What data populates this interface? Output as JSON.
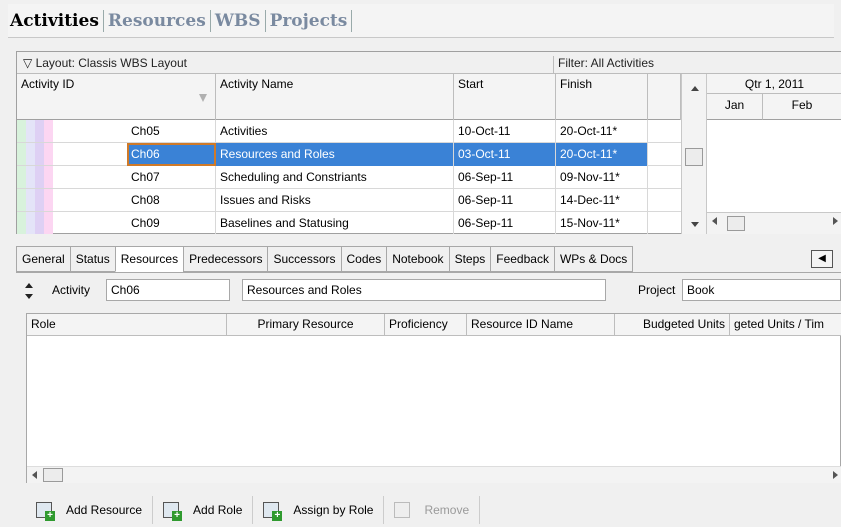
{
  "nav": {
    "tabs": [
      "Activities",
      "Resources",
      "WBS",
      "Projects"
    ]
  },
  "table": {
    "layout": "Layout: Classis WBS Layout",
    "filter": "Filter: All Activities",
    "columns": [
      "Activity ID",
      "Activity Name",
      "Start",
      "Finish"
    ],
    "rows": [
      {
        "id": "Ch05",
        "name": "Activities",
        "start": "10-Oct-11",
        "finish": "20-Oct-11*"
      },
      {
        "id": "Ch06",
        "name": "Resources and Roles",
        "start": "03-Oct-11",
        "finish": "20-Oct-11*"
      },
      {
        "id": "Ch07",
        "name": "Scheduling and Constriants",
        "start": "06-Sep-11",
        "finish": "09-Nov-11*"
      },
      {
        "id": "Ch08",
        "name": "Issues and Risks",
        "start": "06-Sep-11",
        "finish": "14-Dec-11*"
      },
      {
        "id": "Ch09",
        "name": "Baselines and Statusing",
        "start": "06-Sep-11",
        "finish": "15-Nov-11*"
      }
    ],
    "stripe_colors": [
      "#d8f2dc",
      "#e4e4f8",
      "#ded0f4",
      "#fcd6f2"
    ]
  },
  "gantt": {
    "quarter": "Qtr 1, 2011",
    "months": [
      "Jan",
      "Feb"
    ]
  },
  "detail": {
    "tabs": [
      "General",
      "Status",
      "Resources",
      "Predecessors",
      "Successors",
      "Codes",
      "Notebook",
      "Steps",
      "Feedback",
      "WPs & Docs"
    ],
    "activity_label": "Activity",
    "activity_id": "Ch06",
    "activity_name": "Resources and Roles",
    "project_label": "Project",
    "project": "Book",
    "grid_columns": [
      "Role",
      "Primary Resource",
      "Proficiency",
      "Resource ID Name",
      "Budgeted Units",
      "geted Units / Tim"
    ],
    "buttons": [
      "Add Resource",
      "Add Role",
      "Assign by Role",
      "Remove"
    ]
  }
}
